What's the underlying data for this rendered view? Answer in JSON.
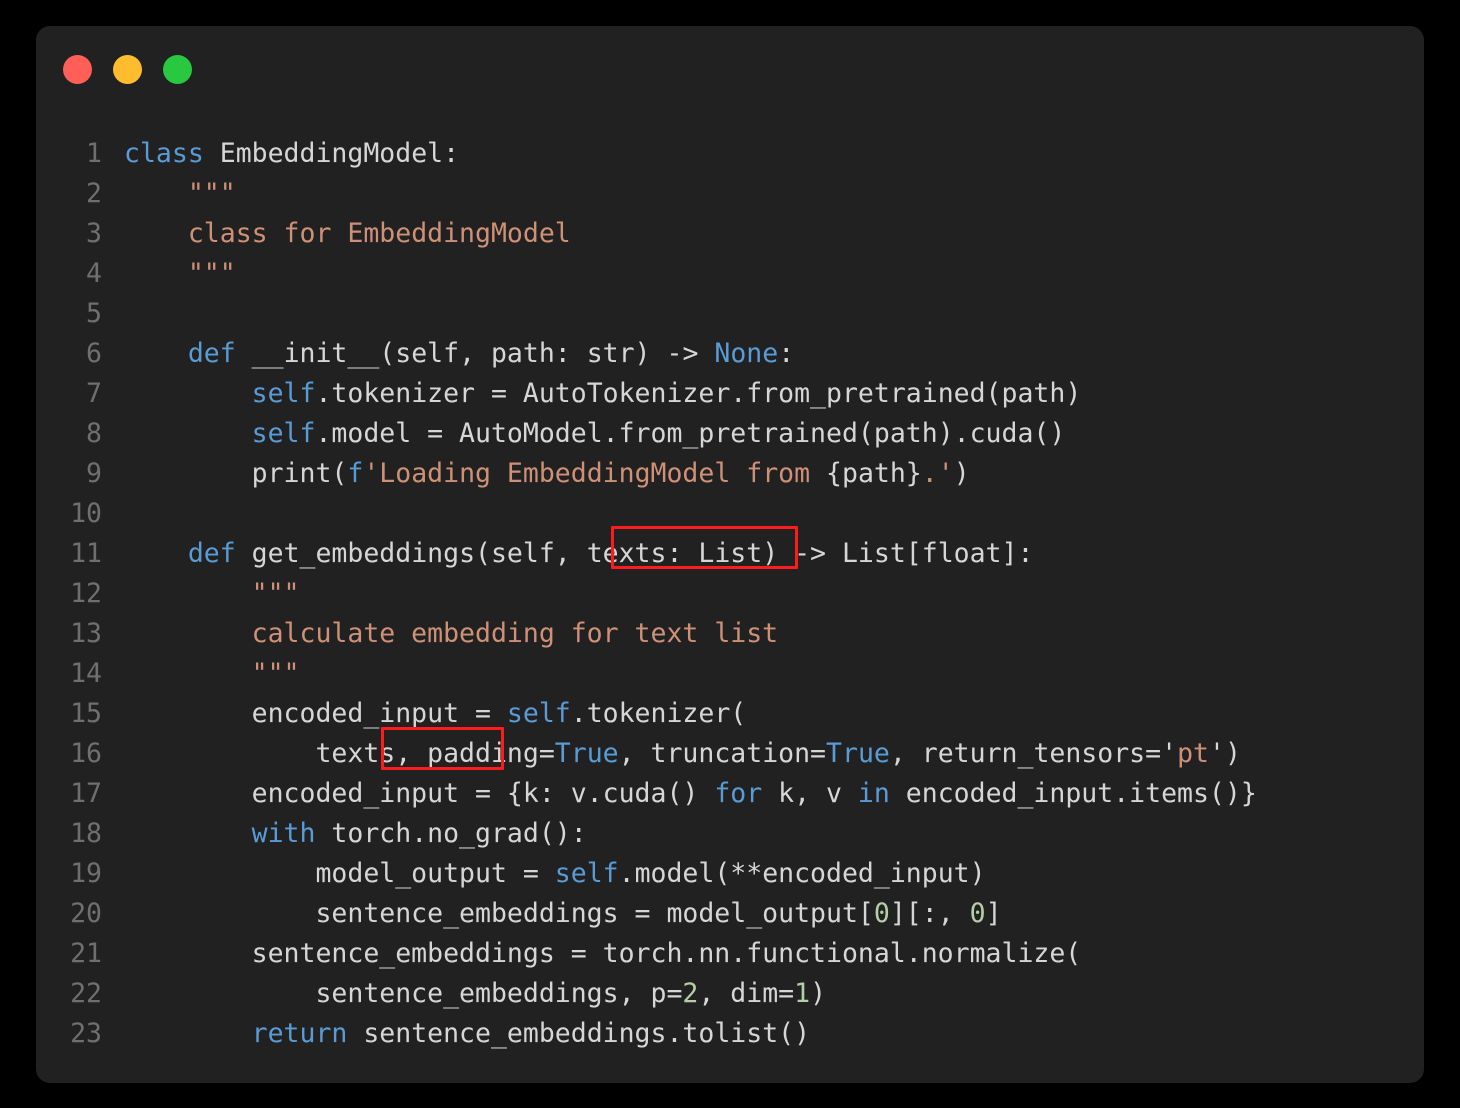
{
  "window": {
    "titlebar": {
      "buttons": [
        {
          "name": "close-button",
          "icon": "circle-icon",
          "color": "#ff5f56"
        },
        {
          "name": "minimize-button",
          "icon": "circle-icon",
          "color": "#ffbd2e"
        },
        {
          "name": "maximize-button",
          "icon": "circle-icon",
          "color": "#28c840"
        }
      ]
    },
    "background": "#212121",
    "page_background": "#000000"
  },
  "theme": {
    "plain": "#d6d6d6",
    "keyword": "#5a9bd5",
    "string": "#ce9178",
    "number": "#b5cea8",
    "lineno": "#6f6f6f",
    "highlight": "#fb1d1d"
  },
  "code": {
    "language": "python",
    "line_numbers": [
      "1",
      "2",
      "3",
      "4",
      "5",
      "6",
      "7",
      "8",
      "9",
      "10",
      "11",
      "12",
      "13",
      "14",
      "15",
      "16",
      "17",
      "18",
      "19",
      "20",
      "21",
      "22",
      "23"
    ],
    "lines": [
      "class EmbeddingModel:",
      "    \"\"\"",
      "    class for EmbeddingModel",
      "    \"\"\"",
      "",
      "    def __init__(self, path: str) -> None:",
      "        self.tokenizer = AutoTokenizer.from_pretrained(path)",
      "        self.model = AutoModel.from_pretrained(path).cuda()",
      "        print(f'Loading EmbeddingModel from {path}.')",
      "",
      "    def get_embeddings(self, texts: List) -> List[float]:",
      "        \"\"\"",
      "        calculate embedding for text list",
      "        \"\"\"",
      "        encoded_input = self.tokenizer(",
      "            texts, padding=True, truncation=True, return_tensors='pt')",
      "        encoded_input = {k: v.cuda() for k, v in encoded_input.items()}",
      "        with torch.no_grad():",
      "            model_output = self.model(**encoded_input)",
      "            sentence_embeddings = model_output[0][:, 0]",
      "        sentence_embeddings = torch.nn.functional.normalize(",
      "            sentence_embeddings, p=2, dim=1)",
      "        return sentence_embeddings.tolist()"
    ],
    "tokens": [
      [
        {
          "t": "class",
          "c": "kw"
        },
        {
          "t": " EmbeddingModel:",
          "c": "pl"
        }
      ],
      [
        {
          "t": "    ",
          "c": "pl"
        },
        {
          "t": "\"\"\"",
          "c": "str"
        }
      ],
      [
        {
          "t": "    ",
          "c": "pl"
        },
        {
          "t": "class for EmbeddingModel",
          "c": "str"
        }
      ],
      [
        {
          "t": "    ",
          "c": "pl"
        },
        {
          "t": "\"\"\"",
          "c": "str"
        }
      ],
      [
        {
          "t": "",
          "c": "pl"
        }
      ],
      [
        {
          "t": "    ",
          "c": "pl"
        },
        {
          "t": "def",
          "c": "kw"
        },
        {
          "t": " __init__(self, path: str) ",
          "c": "pl"
        },
        {
          "t": "->",
          "c": "pl"
        },
        {
          "t": " ",
          "c": "pl"
        },
        {
          "t": "None",
          "c": "kw"
        },
        {
          "t": ":",
          "c": "pl"
        }
      ],
      [
        {
          "t": "        ",
          "c": "pl"
        },
        {
          "t": "self",
          "c": "sf"
        },
        {
          "t": ".tokenizer = AutoTokenizer.from_pretrained(path)",
          "c": "pl"
        }
      ],
      [
        {
          "t": "        ",
          "c": "pl"
        },
        {
          "t": "self",
          "c": "sf"
        },
        {
          "t": ".model = AutoModel.from_pretrained(path).cuda()",
          "c": "pl"
        }
      ],
      [
        {
          "t": "        print(",
          "c": "pl"
        },
        {
          "t": "f",
          "c": "kw"
        },
        {
          "t": "'Loading EmbeddingModel from ",
          "c": "str"
        },
        {
          "t": "{path}",
          "c": "ins"
        },
        {
          "t": ".'",
          "c": "str"
        },
        {
          "t": ")",
          "c": "pl"
        }
      ],
      [
        {
          "t": "",
          "c": "pl"
        }
      ],
      [
        {
          "t": "    ",
          "c": "pl"
        },
        {
          "t": "def",
          "c": "kw"
        },
        {
          "t": " get_embeddings(self, texts: List) -> List[float]:",
          "c": "pl"
        }
      ],
      [
        {
          "t": "        ",
          "c": "pl"
        },
        {
          "t": "\"\"\"",
          "c": "str"
        }
      ],
      [
        {
          "t": "        ",
          "c": "pl"
        },
        {
          "t": "calculate embedding for text list",
          "c": "str"
        }
      ],
      [
        {
          "t": "        ",
          "c": "pl"
        },
        {
          "t": "\"\"\"",
          "c": "str"
        }
      ],
      [
        {
          "t": "        encoded_input = ",
          "c": "pl"
        },
        {
          "t": "self",
          "c": "sf"
        },
        {
          "t": ".tokenizer(",
          "c": "pl"
        }
      ],
      [
        {
          "t": "            texts, padding=",
          "c": "pl"
        },
        {
          "t": "True",
          "c": "kw"
        },
        {
          "t": ", truncation=",
          "c": "pl"
        },
        {
          "t": "True",
          "c": "kw"
        },
        {
          "t": ", return_tensors=",
          "c": "pl"
        },
        {
          "t": "'",
          "c": "pl"
        },
        {
          "t": "pt",
          "c": "str"
        },
        {
          "t": "'",
          "c": "pl"
        },
        {
          "t": ")",
          "c": "pl"
        }
      ],
      [
        {
          "t": "        encoded_input = {k: v.cuda() ",
          "c": "pl"
        },
        {
          "t": "for",
          "c": "kw"
        },
        {
          "t": " k, v ",
          "c": "pl"
        },
        {
          "t": "in",
          "c": "kw"
        },
        {
          "t": " encoded_input.items()}",
          "c": "pl"
        }
      ],
      [
        {
          "t": "        ",
          "c": "pl"
        },
        {
          "t": "with",
          "c": "kw"
        },
        {
          "t": " torch.no_grad():",
          "c": "pl"
        }
      ],
      [
        {
          "t": "            model_output = ",
          "c": "pl"
        },
        {
          "t": "self",
          "c": "sf"
        },
        {
          "t": ".model(**encoded_input)",
          "c": "pl"
        }
      ],
      [
        {
          "t": "            sentence_embeddings = model_output[",
          "c": "pl"
        },
        {
          "t": "0",
          "c": "num"
        },
        {
          "t": "][:, ",
          "c": "pl"
        },
        {
          "t": "0",
          "c": "num"
        },
        {
          "t": "]",
          "c": "pl"
        }
      ],
      [
        {
          "t": "        sentence_embeddings = torch.nn.functional.normalize(",
          "c": "pl"
        }
      ],
      [
        {
          "t": "            sentence_embeddings, p=",
          "c": "pl"
        },
        {
          "t": "2",
          "c": "num"
        },
        {
          "t": ", dim=",
          "c": "pl"
        },
        {
          "t": "1",
          "c": "num"
        },
        {
          "t": ")",
          "c": "pl"
        }
      ],
      [
        {
          "t": "        ",
          "c": "pl"
        },
        {
          "t": "return",
          "c": "kw"
        },
        {
          "t": " sentence_embeddings.tolist()",
          "c": "pl"
        }
      ]
    ]
  },
  "annotations": [
    {
      "name": "highlight-box-texts-list",
      "target_text": "texts: List",
      "line": 11,
      "color": "#fb1d1d"
    },
    {
      "name": "highlight-box-texts-arg",
      "target_text": "texts,",
      "line": 16,
      "color": "#fb1d1d"
    }
  ]
}
